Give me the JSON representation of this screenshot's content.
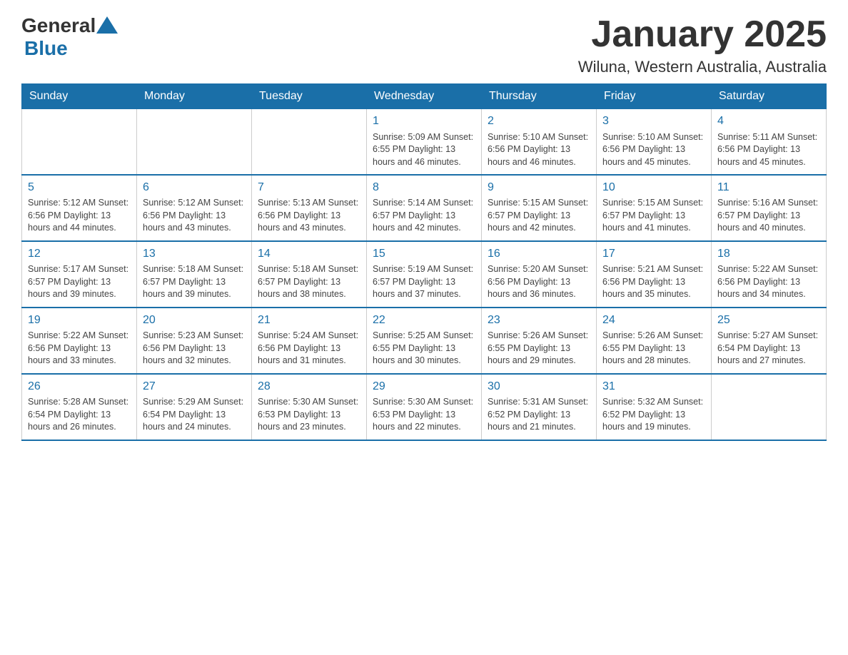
{
  "header": {
    "logo_general": "General",
    "logo_blue": "Blue",
    "month_title": "January 2025",
    "location": "Wiluna, Western Australia, Australia"
  },
  "weekdays": [
    "Sunday",
    "Monday",
    "Tuesday",
    "Wednesday",
    "Thursday",
    "Friday",
    "Saturday"
  ],
  "weeks": [
    [
      {
        "day": "",
        "info": ""
      },
      {
        "day": "",
        "info": ""
      },
      {
        "day": "",
        "info": ""
      },
      {
        "day": "1",
        "info": "Sunrise: 5:09 AM\nSunset: 6:55 PM\nDaylight: 13 hours and 46 minutes."
      },
      {
        "day": "2",
        "info": "Sunrise: 5:10 AM\nSunset: 6:56 PM\nDaylight: 13 hours and 46 minutes."
      },
      {
        "day": "3",
        "info": "Sunrise: 5:10 AM\nSunset: 6:56 PM\nDaylight: 13 hours and 45 minutes."
      },
      {
        "day": "4",
        "info": "Sunrise: 5:11 AM\nSunset: 6:56 PM\nDaylight: 13 hours and 45 minutes."
      }
    ],
    [
      {
        "day": "5",
        "info": "Sunrise: 5:12 AM\nSunset: 6:56 PM\nDaylight: 13 hours and 44 minutes."
      },
      {
        "day": "6",
        "info": "Sunrise: 5:12 AM\nSunset: 6:56 PM\nDaylight: 13 hours and 43 minutes."
      },
      {
        "day": "7",
        "info": "Sunrise: 5:13 AM\nSunset: 6:56 PM\nDaylight: 13 hours and 43 minutes."
      },
      {
        "day": "8",
        "info": "Sunrise: 5:14 AM\nSunset: 6:57 PM\nDaylight: 13 hours and 42 minutes."
      },
      {
        "day": "9",
        "info": "Sunrise: 5:15 AM\nSunset: 6:57 PM\nDaylight: 13 hours and 42 minutes."
      },
      {
        "day": "10",
        "info": "Sunrise: 5:15 AM\nSunset: 6:57 PM\nDaylight: 13 hours and 41 minutes."
      },
      {
        "day": "11",
        "info": "Sunrise: 5:16 AM\nSunset: 6:57 PM\nDaylight: 13 hours and 40 minutes."
      }
    ],
    [
      {
        "day": "12",
        "info": "Sunrise: 5:17 AM\nSunset: 6:57 PM\nDaylight: 13 hours and 39 minutes."
      },
      {
        "day": "13",
        "info": "Sunrise: 5:18 AM\nSunset: 6:57 PM\nDaylight: 13 hours and 39 minutes."
      },
      {
        "day": "14",
        "info": "Sunrise: 5:18 AM\nSunset: 6:57 PM\nDaylight: 13 hours and 38 minutes."
      },
      {
        "day": "15",
        "info": "Sunrise: 5:19 AM\nSunset: 6:57 PM\nDaylight: 13 hours and 37 minutes."
      },
      {
        "day": "16",
        "info": "Sunrise: 5:20 AM\nSunset: 6:56 PM\nDaylight: 13 hours and 36 minutes."
      },
      {
        "day": "17",
        "info": "Sunrise: 5:21 AM\nSunset: 6:56 PM\nDaylight: 13 hours and 35 minutes."
      },
      {
        "day": "18",
        "info": "Sunrise: 5:22 AM\nSunset: 6:56 PM\nDaylight: 13 hours and 34 minutes."
      }
    ],
    [
      {
        "day": "19",
        "info": "Sunrise: 5:22 AM\nSunset: 6:56 PM\nDaylight: 13 hours and 33 minutes."
      },
      {
        "day": "20",
        "info": "Sunrise: 5:23 AM\nSunset: 6:56 PM\nDaylight: 13 hours and 32 minutes."
      },
      {
        "day": "21",
        "info": "Sunrise: 5:24 AM\nSunset: 6:56 PM\nDaylight: 13 hours and 31 minutes."
      },
      {
        "day": "22",
        "info": "Sunrise: 5:25 AM\nSunset: 6:55 PM\nDaylight: 13 hours and 30 minutes."
      },
      {
        "day": "23",
        "info": "Sunrise: 5:26 AM\nSunset: 6:55 PM\nDaylight: 13 hours and 29 minutes."
      },
      {
        "day": "24",
        "info": "Sunrise: 5:26 AM\nSunset: 6:55 PM\nDaylight: 13 hours and 28 minutes."
      },
      {
        "day": "25",
        "info": "Sunrise: 5:27 AM\nSunset: 6:54 PM\nDaylight: 13 hours and 27 minutes."
      }
    ],
    [
      {
        "day": "26",
        "info": "Sunrise: 5:28 AM\nSunset: 6:54 PM\nDaylight: 13 hours and 26 minutes."
      },
      {
        "day": "27",
        "info": "Sunrise: 5:29 AM\nSunset: 6:54 PM\nDaylight: 13 hours and 24 minutes."
      },
      {
        "day": "28",
        "info": "Sunrise: 5:30 AM\nSunset: 6:53 PM\nDaylight: 13 hours and 23 minutes."
      },
      {
        "day": "29",
        "info": "Sunrise: 5:30 AM\nSunset: 6:53 PM\nDaylight: 13 hours and 22 minutes."
      },
      {
        "day": "30",
        "info": "Sunrise: 5:31 AM\nSunset: 6:52 PM\nDaylight: 13 hours and 21 minutes."
      },
      {
        "day": "31",
        "info": "Sunrise: 5:32 AM\nSunset: 6:52 PM\nDaylight: 13 hours and 19 minutes."
      },
      {
        "day": "",
        "info": ""
      }
    ]
  ]
}
